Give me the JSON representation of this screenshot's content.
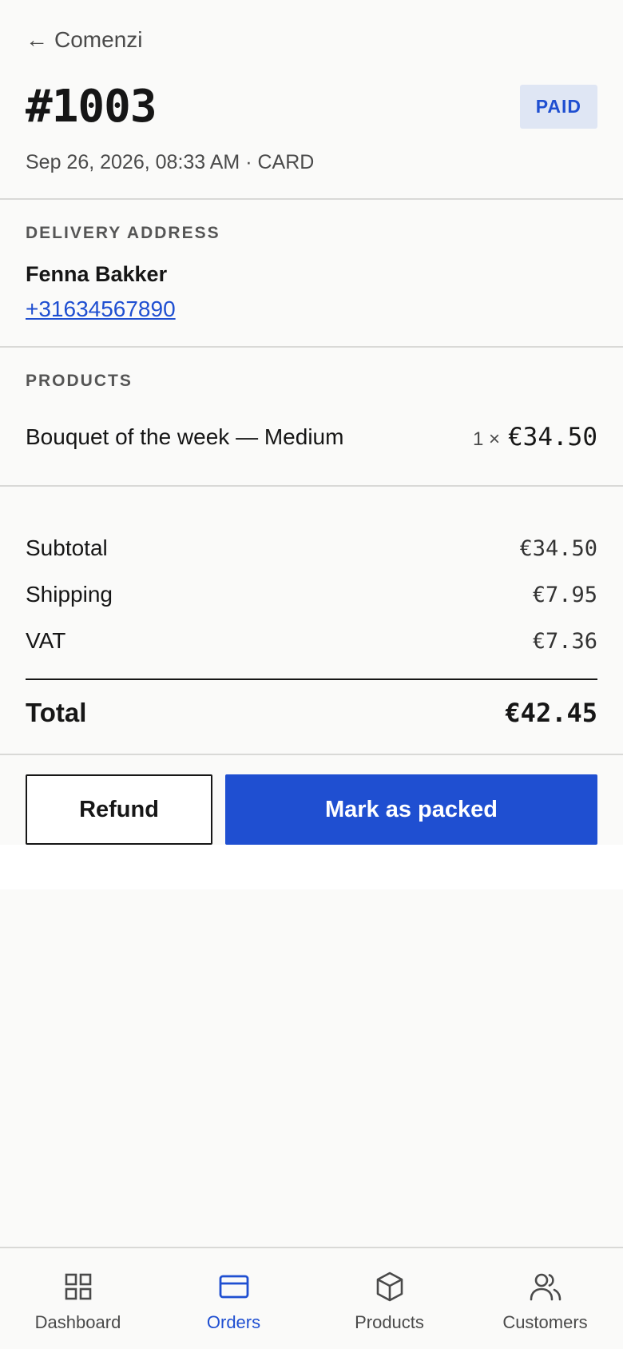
{
  "nav": {
    "back_label": "Comenzi"
  },
  "order": {
    "id": "#1003",
    "status": "PAID",
    "meta": "Sep 26, 2026, 08:33 AM · CARD"
  },
  "delivery": {
    "title": "DELIVERY ADDRESS",
    "name": "Fenna Bakker",
    "phone": "+31634567890"
  },
  "products": {
    "title": "PRODUCTS",
    "items": [
      {
        "name": "Bouquet of the week — Medium",
        "qty": "1 ×",
        "price": "€34.50"
      }
    ]
  },
  "summary": {
    "subtotal_label": "Subtotal",
    "subtotal": "€34.50",
    "shipping_label": "Shipping",
    "shipping": "€7.95",
    "vat_label": "VAT",
    "vat": "€7.36",
    "total_label": "Total",
    "total": "€42.45"
  },
  "actions": {
    "refund": "Refund",
    "primary": "Mark as packed"
  },
  "tabs": [
    {
      "label": "Dashboard",
      "icon": "grid-icon"
    },
    {
      "label": "Orders",
      "icon": "card-icon"
    },
    {
      "label": "Products",
      "icon": "box-icon"
    },
    {
      "label": "Customers",
      "icon": "users-icon"
    }
  ],
  "colors": {
    "accent": "#1f4fd1",
    "badge_bg": "#dfe6f4",
    "background": "#fafaf9"
  }
}
